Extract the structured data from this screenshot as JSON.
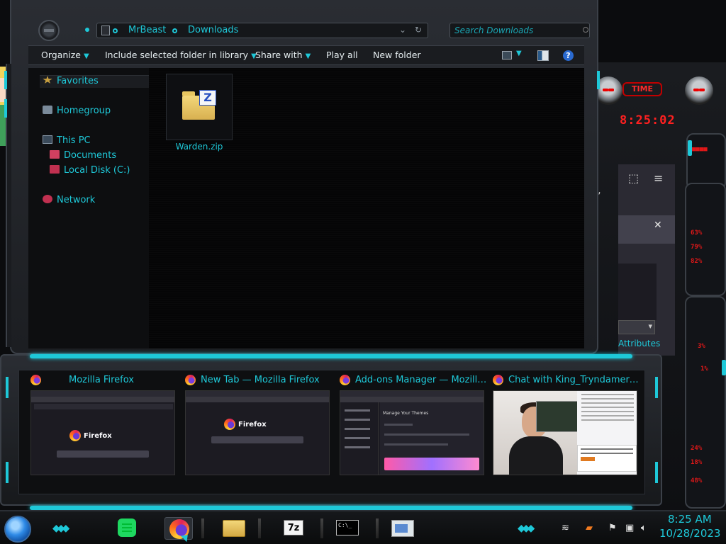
{
  "explorer": {
    "breadcrumb": [
      "MrBeast",
      "Downloads"
    ],
    "search_placeholder": "Search Downloads",
    "toolbar": {
      "organize": "Organize",
      "include_library": "Include selected folder in library",
      "share_with": "Share with",
      "play_all": "Play all",
      "new_folder": "New folder",
      "help": "?"
    },
    "nav": {
      "favorites": "Favorites",
      "homegroup": "Homegroup",
      "this_pc": "This PC",
      "documents": "Documents",
      "local_disk": "Local Disk (C:)",
      "network": "Network"
    },
    "files": [
      {
        "name": "Warden.zip",
        "icon": "zip-archive-icon"
      }
    ]
  },
  "gadget": {
    "badge": "TIME",
    "clock": "8:25:02",
    "readouts": [
      "63%",
      "79%",
      "82%",
      "3%",
      "1%",
      "24%",
      "18%",
      "48%"
    ]
  },
  "firefox_panel": {
    "fragment": "r,",
    "attributes_tab": "Attributes",
    "close": "✕"
  },
  "preview": {
    "windows": [
      {
        "title": "Mozilla Firefox",
        "thumb_label": "Firefox"
      },
      {
        "title": "New Tab — Mozilla Firefox",
        "thumb_label": "Firefox"
      },
      {
        "title": "Add-ons Manager — Mozilla...",
        "thumb_label": "Manage Your Themes"
      },
      {
        "title": "Chat with King_Tryndamere i...",
        "thumb_label": ""
      }
    ]
  },
  "taskbar": {
    "apps": [
      {
        "name": "Spotify",
        "icon": "spotify-icon"
      },
      {
        "name": "Firefox",
        "icon": "firefox-icon"
      },
      {
        "name": "File Explorer",
        "icon": "folder-icon"
      },
      {
        "name": "7-Zip",
        "icon": "7zip-icon",
        "label": "7z"
      },
      {
        "name": "Command Prompt",
        "icon": "cmd-icon",
        "label": "C:\\_"
      },
      {
        "name": "Paint",
        "icon": "paint-icon"
      }
    ],
    "tray": {
      "time": "8:25 AM",
      "date": "10/28/2023"
    }
  },
  "colors": {
    "accent": "#1ec8d8",
    "gadget_red": "#ff2020",
    "folder_yellow": "#f3d77a"
  }
}
